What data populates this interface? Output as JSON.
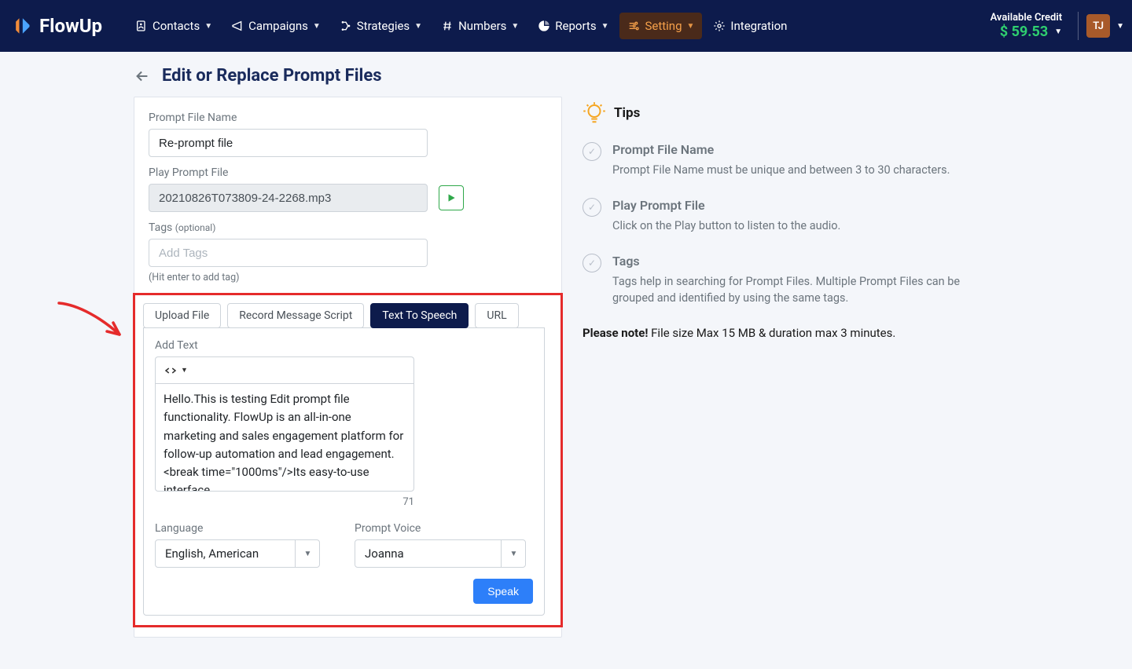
{
  "brand": "FlowUp",
  "nav": {
    "contacts": "Contacts",
    "campaigns": "Campaigns",
    "strategies": "Strategies",
    "numbers": "Numbers",
    "reports": "Reports",
    "setting": "Setting",
    "integration": "Integration"
  },
  "credit": {
    "label": "Available Credit",
    "amount": "$ 59.53"
  },
  "user_initials": "TJ",
  "page_title": "Edit or Replace Prompt Files",
  "form": {
    "name_label": "Prompt File Name",
    "name_value": "Re-prompt file",
    "play_label": "Play Prompt File",
    "play_value": "20210826T073809-24-2268.mp3",
    "tags_label": "Tags ",
    "tags_opt": "(optional)",
    "tags_placeholder": "Add Tags",
    "tags_hint": "(Hit enter to add tag)"
  },
  "tabs": {
    "upload": "Upload File",
    "record": "Record Message Script",
    "tts": "Text To Speech",
    "url": "URL"
  },
  "tts": {
    "add_text_label": "Add Text",
    "text_value": "Hello.This is testing Edit prompt file functionality. FlowUp is an all-in-one marketing and sales engagement platform for follow-up automation and lead engagement.<break time=\"1000ms\"/>Its easy-to-use interface",
    "char_count": "71",
    "language_label": "Language",
    "language_value": "English, American",
    "voice_label": "Prompt Voice",
    "voice_value": "Joanna",
    "speak": "Speak"
  },
  "tips": {
    "title": "Tips",
    "items": [
      {
        "heading": "Prompt File Name",
        "body": "Prompt File Name must be unique and between 3 to 30 characters."
      },
      {
        "heading": "Play Prompt File",
        "body": "Click on the Play button to listen to the audio."
      },
      {
        "heading": "Tags",
        "body": "Tags help in searching for Prompt Files. Multiple Prompt Files can be grouped and identified by using the same tags."
      }
    ],
    "note_prefix": "Please note!",
    "note_body": " File size Max 15 MB & duration max 3 minutes."
  }
}
